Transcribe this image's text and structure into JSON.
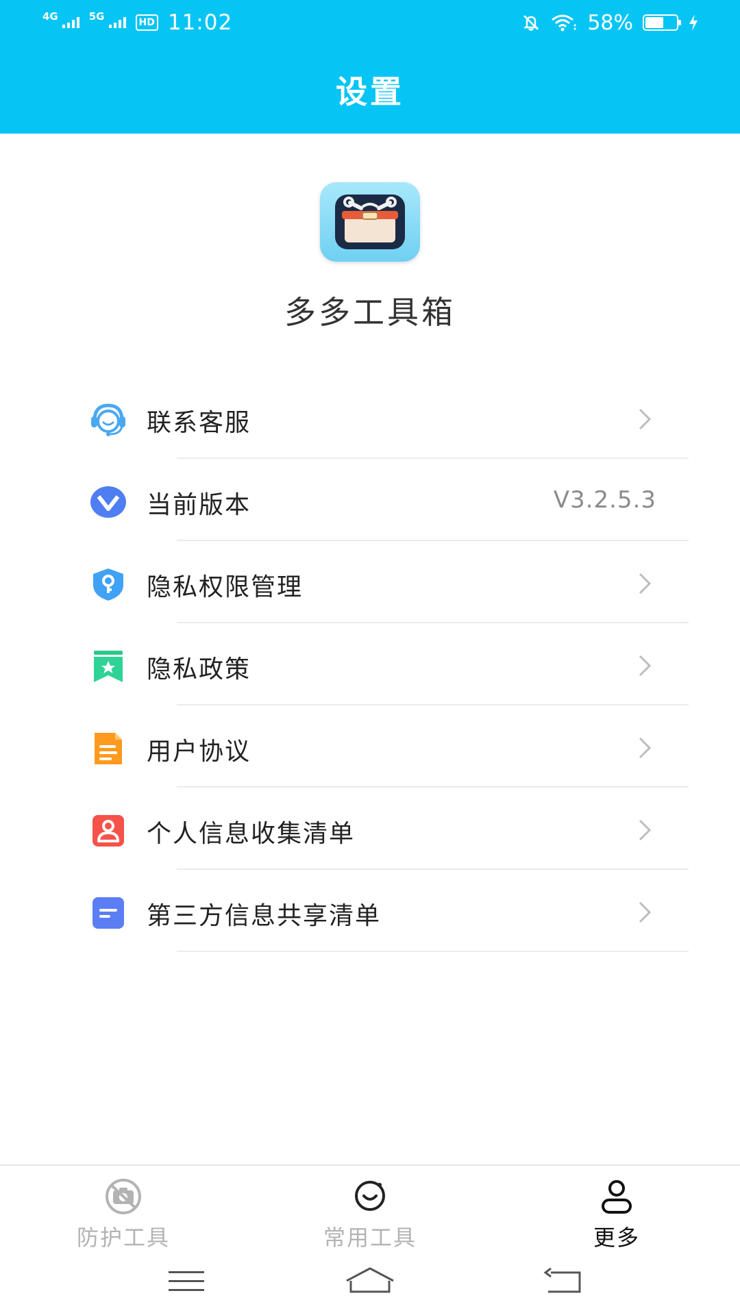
{
  "status_bar": {
    "network_1": "4G",
    "network_2": "5G",
    "hd_badge": "HD",
    "time": "11:02",
    "battery_text": "58%",
    "battery_level": 0.58
  },
  "header": {
    "title": "设置"
  },
  "app": {
    "name": "多多工具箱"
  },
  "menu": {
    "items": [
      {
        "label": "联系客服",
        "icon": "customer-service-icon"
      },
      {
        "label": "当前版本",
        "icon": "version-icon",
        "value": "V3.2.5.3"
      },
      {
        "label": "隐私权限管理",
        "icon": "shield-key-icon"
      },
      {
        "label": "隐私政策",
        "icon": "bookmark-star-icon"
      },
      {
        "label": "用户协议",
        "icon": "document-icon"
      },
      {
        "label": "个人信息收集清单",
        "icon": "person-icon"
      },
      {
        "label": "第三方信息共享清单",
        "icon": "list-icon"
      }
    ]
  },
  "tabbar": {
    "tabs": [
      {
        "label": "防护工具",
        "icon": "no-camera-icon",
        "active": false
      },
      {
        "label": "常用工具",
        "icon": "smile-icon",
        "active": false
      },
      {
        "label": "更多",
        "icon": "user-icon",
        "active": true
      }
    ]
  },
  "colors": {
    "header": "#06c5f5",
    "tab_active": "#111111",
    "tab_inactive": "#b3b3b3"
  }
}
